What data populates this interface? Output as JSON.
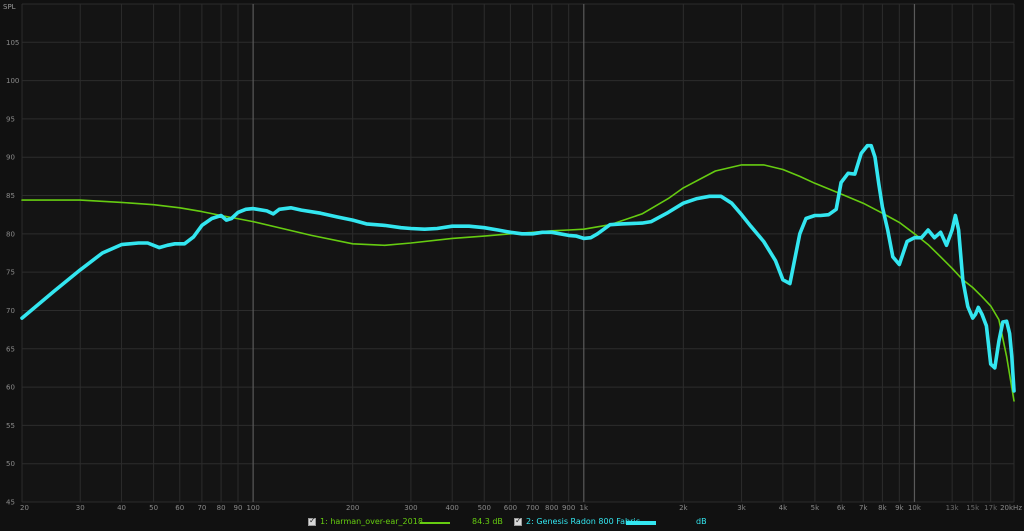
{
  "chart_data": {
    "type": "line",
    "ylabel": "SPL",
    "xscale": "log",
    "xlim": [
      20,
      20000
    ],
    "ylim": [
      45,
      110
    ],
    "grid": true,
    "yticks": [
      45,
      50,
      55,
      60,
      65,
      70,
      75,
      80,
      85,
      90,
      95,
      100,
      105
    ],
    "xticks": [
      {
        "value": 20,
        "label": "20"
      },
      {
        "value": 30,
        "label": "30"
      },
      {
        "value": 40,
        "label": "40"
      },
      {
        "value": 50,
        "label": "50"
      },
      {
        "value": 60,
        "label": "60"
      },
      {
        "value": 70,
        "label": "70"
      },
      {
        "value": 80,
        "label": "80"
      },
      {
        "value": 90,
        "label": "90"
      },
      {
        "value": 100,
        "label": "100"
      },
      {
        "value": 200,
        "label": "200"
      },
      {
        "value": 300,
        "label": "300"
      },
      {
        "value": 400,
        "label": "400"
      },
      {
        "value": 500,
        "label": "500"
      },
      {
        "value": 600,
        "label": "600"
      },
      {
        "value": 700,
        "label": "700"
      },
      {
        "value": 800,
        "label": "800"
      },
      {
        "value": 900,
        "label": "900"
      },
      {
        "value": 1000,
        "label": "1k"
      },
      {
        "value": 2000,
        "label": "2k"
      },
      {
        "value": 3000,
        "label": "3k"
      },
      {
        "value": 4000,
        "label": "4k"
      },
      {
        "value": 5000,
        "label": "5k"
      },
      {
        "value": 6000,
        "label": "6k"
      },
      {
        "value": 7000,
        "label": "7k"
      },
      {
        "value": 8000,
        "label": "8k"
      },
      {
        "value": 9000,
        "label": "9k"
      },
      {
        "value": 10000,
        "label": "10k"
      },
      {
        "value": 13000,
        "label": "13k"
      },
      {
        "value": 15000,
        "label": "15k"
      },
      {
        "value": 17000,
        "label": "17k"
      },
      {
        "value": 20000,
        "label": "20kHz"
      }
    ],
    "major_xlines": [
      100,
      1000,
      10000
    ],
    "series": [
      {
        "name": "1: harman_over-ear_2018",
        "value_label": "84.3 dB",
        "color": "#66cc11",
        "x": [
          20,
          30,
          40,
          50,
          60,
          70,
          80,
          100,
          150,
          200,
          250,
          300,
          400,
          500,
          600,
          700,
          800,
          900,
          1000,
          1200,
          1500,
          1800,
          2000,
          2500,
          3000,
          3500,
          4000,
          4500,
          5000,
          6000,
          7000,
          8000,
          9000,
          10000,
          11000,
          12000,
          13000,
          14000,
          15000,
          16000,
          17000,
          18000,
          19000,
          20000
        ],
        "y": [
          84.4,
          84.4,
          84.1,
          83.8,
          83.4,
          82.9,
          82.4,
          81.6,
          79.8,
          78.7,
          78.5,
          78.8,
          79.4,
          79.7,
          80.0,
          80.2,
          80.4,
          80.5,
          80.6,
          81.2,
          82.6,
          84.6,
          86.0,
          88.2,
          89.0,
          89.0,
          88.4,
          87.5,
          86.6,
          85.2,
          84.0,
          82.7,
          81.5,
          80.0,
          78.6,
          77.0,
          75.5,
          74.0,
          73.0,
          71.8,
          70.6,
          68.8,
          64.0,
          58.2
        ]
      },
      {
        "name": "2: Genesis Radon 800 Fabric",
        "value_label": "dB",
        "color": "#33e6f0",
        "x": [
          20,
          25,
          30,
          35,
          40,
          45,
          48,
          52,
          55,
          58,
          62,
          66,
          70,
          75,
          80,
          83,
          86,
          90,
          95,
          100,
          110,
          115,
          120,
          130,
          140,
          160,
          180,
          200,
          220,
          250,
          280,
          300,
          330,
          360,
          400,
          450,
          500,
          550,
          600,
          650,
          700,
          750,
          800,
          900,
          950,
          1000,
          1050,
          1100,
          1200,
          1300,
          1500,
          1600,
          1800,
          2000,
          2200,
          2400,
          2600,
          2800,
          3000,
          3200,
          3500,
          3800,
          4000,
          4200,
          4500,
          4700,
          5000,
          5200,
          5500,
          5800,
          6000,
          6300,
          6600,
          6900,
          7200,
          7400,
          7600,
          7800,
          8000,
          8300,
          8600,
          9000,
          9500,
          10000,
          10500,
          11000,
          11500,
          12000,
          12500,
          13000,
          13300,
          13600,
          14000,
          14500,
          15000,
          15300,
          15600,
          16000,
          16500,
          17000,
          17500,
          18000,
          18500,
          19000,
          19400,
          19700,
          20000
        ],
        "y": [
          69.0,
          72.5,
          75.3,
          77.5,
          78.6,
          78.8,
          78.8,
          78.2,
          78.5,
          78.7,
          78.7,
          79.6,
          81.1,
          82.0,
          82.4,
          81.8,
          82.0,
          82.8,
          83.2,
          83.3,
          83.0,
          82.6,
          83.2,
          83.4,
          83.1,
          82.7,
          82.2,
          81.8,
          81.3,
          81.1,
          80.8,
          80.7,
          80.6,
          80.7,
          81.0,
          81.0,
          80.8,
          80.5,
          80.2,
          80.0,
          80.0,
          80.2,
          80.2,
          79.8,
          79.7,
          79.4,
          79.5,
          80.0,
          81.2,
          81.3,
          81.4,
          81.6,
          82.8,
          84.0,
          84.6,
          84.9,
          84.9,
          84.0,
          82.5,
          81.0,
          79.0,
          76.5,
          74.0,
          73.5,
          80.0,
          82.0,
          82.4,
          82.4,
          82.5,
          83.2,
          86.7,
          87.9,
          87.8,
          90.5,
          91.5,
          91.5,
          90.0,
          86.5,
          83.5,
          80.5,
          77.0,
          76.0,
          79.0,
          79.5,
          79.5,
          80.5,
          79.5,
          80.2,
          78.5,
          80.5,
          82.4,
          80.5,
          74.0,
          70.5,
          69.0,
          69.5,
          70.4,
          69.5,
          68.0,
          63.0,
          62.5,
          66.0,
          68.5,
          68.6,
          67.0,
          64.0,
          59.5
        ]
      }
    ]
  }
}
